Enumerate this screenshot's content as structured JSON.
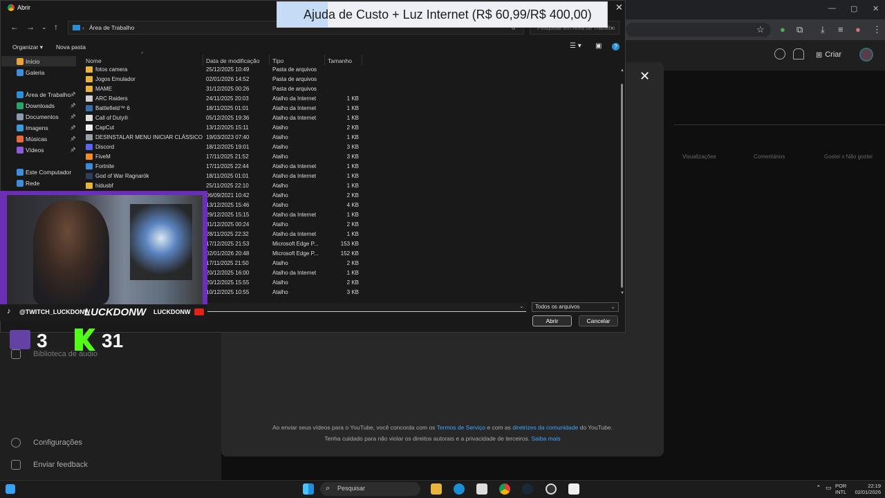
{
  "banner": {
    "text": "Ajuda de Custo + Luz Internet (R$ 60,99/R$ 400,00)"
  },
  "dialog": {
    "title": "Abrir",
    "breadcrumb": "Área de Trabalho",
    "search_placeholder": "Pesquisar em Área de Trabalho",
    "organize": "Organizar",
    "new_folder": "Nova pasta",
    "nav": [
      {
        "label": "Início",
        "color": "#e8a33c",
        "pinned": false,
        "selected": true
      },
      {
        "label": "Galeria",
        "color": "#3b8fd8",
        "pinned": false,
        "selected": false
      },
      {
        "label": "Área de Trabalho",
        "color": "#2a8fd6",
        "pinned": true,
        "selected": false
      },
      {
        "label": "Downloads",
        "color": "#2aa36b",
        "pinned": true,
        "selected": false
      },
      {
        "label": "Documentos",
        "color": "#8a9bb0",
        "pinned": true,
        "selected": false
      },
      {
        "label": "Imagens",
        "color": "#3b9ad8",
        "pinned": true,
        "selected": false
      },
      {
        "label": "Músicas",
        "color": "#e06c3c",
        "pinned": true,
        "selected": false
      },
      {
        "label": "Vídeos",
        "color": "#8b5cd6",
        "pinned": true,
        "selected": false
      },
      {
        "label": "Este Computador",
        "color": "#3b8fd8",
        "pinned": false,
        "selected": false
      },
      {
        "label": "Rede",
        "color": "#3b8fd8",
        "pinned": false,
        "selected": false
      }
    ],
    "columns": {
      "name": "Nome",
      "date": "Data de modificação",
      "type": "Tipo",
      "size": "Tamanho"
    },
    "files": [
      {
        "name": "fotos camera",
        "date": "25/12/2025 10:49",
        "type": "Pasta de arquivos",
        "size": "",
        "icon": "#e8b43c"
      },
      {
        "name": "Jogos Emulador",
        "date": "02/01/2026 14:52",
        "type": "Pasta de arquivos",
        "size": "",
        "icon": "#e8b43c"
      },
      {
        "name": "MAME",
        "date": "31/12/2025 00:26",
        "type": "Pasta de arquivos",
        "size": "",
        "icon": "#e8b43c"
      },
      {
        "name": "ARC Raiders",
        "date": "24/11/2025 20:03",
        "type": "Atalho da Internet",
        "size": "1 KB",
        "icon": "#d0d0d0"
      },
      {
        "name": "Battlefield™ 6",
        "date": "18/11/2025 01:01",
        "type": "Atalho da Internet",
        "size": "1 KB",
        "icon": "#3a6ea8"
      },
      {
        "name": "Call of Duty®",
        "date": "05/12/2025 19:36",
        "type": "Atalho da Internet",
        "size": "1 KB",
        "icon": "#e0e0e0"
      },
      {
        "name": "CapCut",
        "date": "13/12/2025 15:11",
        "type": "Atalho",
        "size": "2 KB",
        "icon": "#f0f0f0"
      },
      {
        "name": "DESINSTALAR MENU INICIAR CLÁSSICO",
        "date": "19/03/2023 07:40",
        "type": "Atalho",
        "size": "1 KB",
        "icon": "#9aa0a8"
      },
      {
        "name": "Discord",
        "date": "18/12/2025 19:01",
        "type": "Atalho",
        "size": "3 KB",
        "icon": "#5865f2"
      },
      {
        "name": "FiveM",
        "date": "17/11/2025 21:52",
        "type": "Atalho",
        "size": "3 KB",
        "icon": "#f28c28"
      },
      {
        "name": "Fortnite",
        "date": "17/11/2025 22:44",
        "type": "Atalho da Internet",
        "size": "1 KB",
        "icon": "#3a8ed8"
      },
      {
        "name": "God of War Ragnarök",
        "date": "18/11/2025 01:01",
        "type": "Atalho da Internet",
        "size": "1 KB",
        "icon": "#2d3e5c"
      },
      {
        "name": "hidusbf",
        "date": "25/11/2025 22:10",
        "type": "Atalho",
        "size": "1 KB",
        "icon": "#e8b43c"
      },
      {
        "name": "",
        "date": "06/09/2021 10:42",
        "type": "Atalho",
        "size": "2 KB",
        "icon": ""
      },
      {
        "name": "",
        "date": "13/12/2025 15:46",
        "type": "Atalho",
        "size": "4 KB",
        "icon": ""
      },
      {
        "name": "",
        "date": "29/12/2025 15:15",
        "type": "Atalho da Internet",
        "size": "1 KB",
        "icon": ""
      },
      {
        "name": "",
        "date": "31/12/2025 00:24",
        "type": "Atalho",
        "size": "2 KB",
        "icon": ""
      },
      {
        "name": "",
        "date": "28/11/2025 22:32",
        "type": "Atalho da Internet",
        "size": "1 KB",
        "icon": ""
      },
      {
        "name": "",
        "date": "17/12/2025 21:53",
        "type": "Microsoft Edge P...",
        "size": "153 KB",
        "icon": ""
      },
      {
        "name": "",
        "date": "02/01/2026 20:48",
        "type": "Microsoft Edge P...",
        "size": "152 KB",
        "icon": ""
      },
      {
        "name": "",
        "date": "17/11/2025 21:50",
        "type": "Atalho",
        "size": "2 KB",
        "icon": ""
      },
      {
        "name": "",
        "date": "20/12/2025 16:00",
        "type": "Atalho da Internet",
        "size": "1 KB",
        "icon": ""
      },
      {
        "name": "",
        "date": "20/12/2025 15:55",
        "type": "Atalho",
        "size": "2 KB",
        "icon": ""
      },
      {
        "name": "",
        "date": "10/12/2025 10:55",
        "type": "Atalho",
        "size": "3 KB",
        "icon": ""
      }
    ],
    "filetype": "Todos os arquivos",
    "open_btn": "Abrir",
    "cancel_btn": "Cancelar"
  },
  "youtube": {
    "create": "Criar",
    "col_views": "Visualizações",
    "col_comments": "Comentários",
    "col_likes": "Gostei x Não gostei",
    "side_library": "Biblioteca de áudio",
    "side_settings": "Configurações",
    "side_feedback": "Enviar feedback",
    "legal_1a": "Ao enviar seus vídeos para o YouTube, você concorda com os ",
    "legal_1b": "Termos de Serviço",
    "legal_1c": " e com as ",
    "legal_1d": "diretrizes da comunidade",
    "legal_1e": " do YouTube.",
    "legal_2a": "Tenha cuidado para não violar os direitos autorais e a privacidade de terceiros. ",
    "legal_2b": "Saiba mais"
  },
  "overlay": {
    "handle": "@TWITCH_LUCKDONW",
    "name_big": "LUCKDONW",
    "name_small": "LUCKDONW",
    "twitch_count": "3",
    "kick_count": "31"
  },
  "taskbar": {
    "search": "Pesquisar",
    "lang1": "POR",
    "lang2": "INTL",
    "time": "22:19",
    "date": "02/01/2026"
  }
}
